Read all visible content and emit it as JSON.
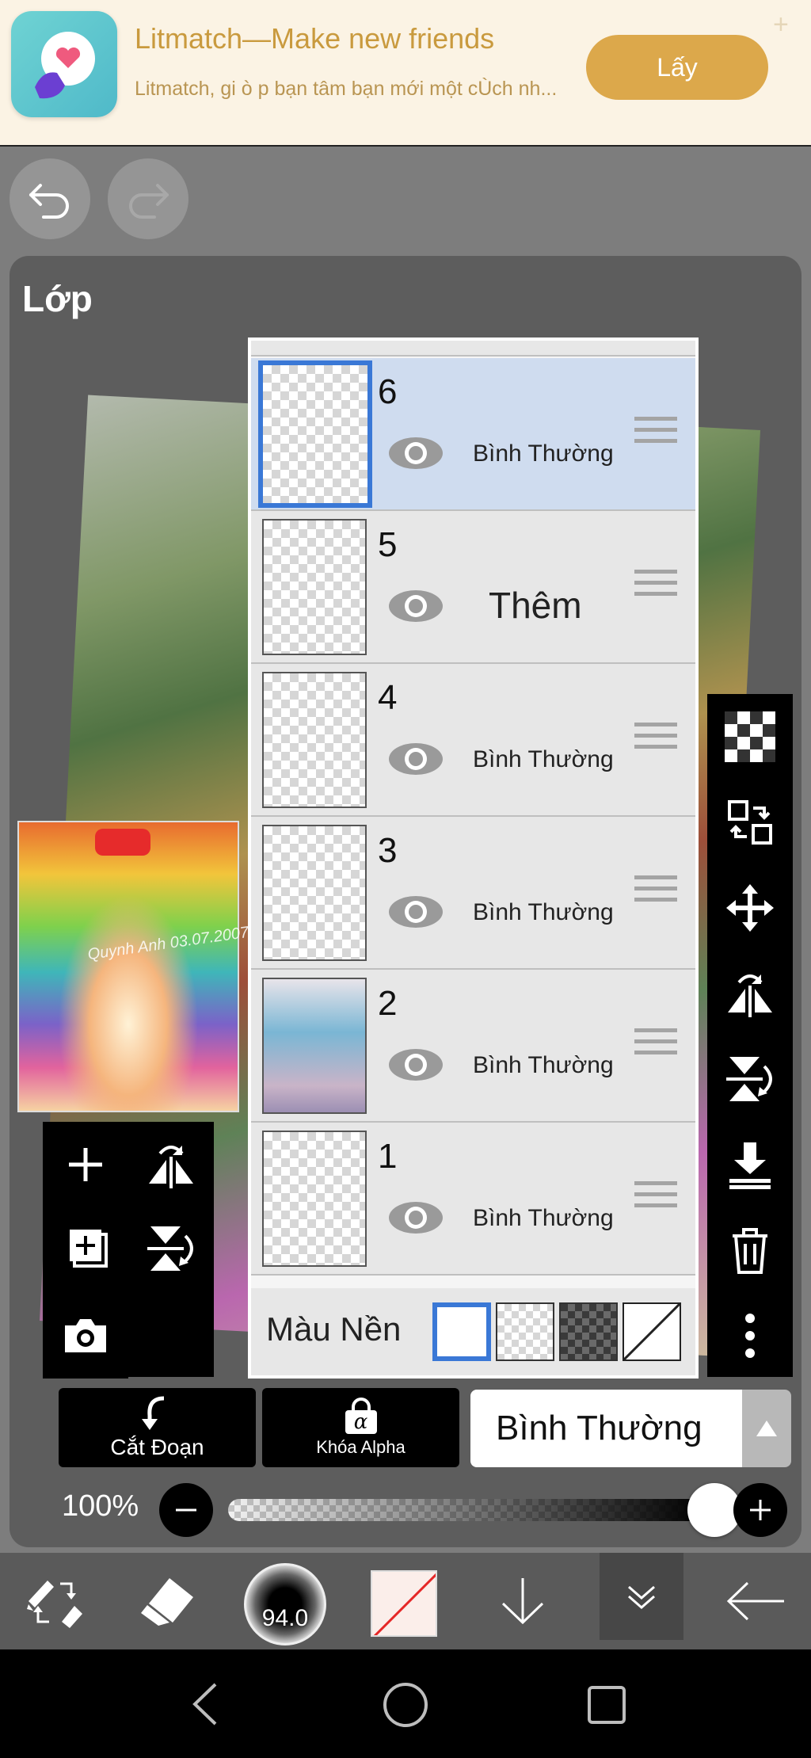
{
  "ad": {
    "title": "Litmatch—Make new friends",
    "subtitle": "Litmatch, gi ò p bạn tâm bạn mới một cÙch nh...",
    "cta": "Lấy",
    "close": "+"
  },
  "panel": {
    "title": "Lớp"
  },
  "layers": [
    {
      "number": "6",
      "mode": "Bình Thường",
      "selected": true
    },
    {
      "number": "5",
      "mode": "Thêm",
      "selected": false
    },
    {
      "number": "4",
      "mode": "Bình Thường",
      "selected": false
    },
    {
      "number": "3",
      "mode": "Bình Thường",
      "selected": false
    },
    {
      "number": "2",
      "mode": "Bình Thường",
      "selected": false
    },
    {
      "number": "1",
      "mode": "Bình Thường",
      "selected": false
    }
  ],
  "background": {
    "label": "Màu Nền",
    "options": [
      "white",
      "transparent",
      "dark-checker",
      "none"
    ],
    "selected": "white"
  },
  "thumbnail": {
    "signature": "Quynh Anh 03.07.2007"
  },
  "controls": {
    "cut_label": "Cắt Đoạn",
    "alpha_label": "Khóa Alpha",
    "alpha_symbol": "α",
    "blend_mode": "Bình Thường",
    "opacity_label": "100%",
    "opacity_value": 1.0
  },
  "toolbar": {
    "brush_size": "94.0"
  },
  "colors": {
    "accent": "#3a78d6",
    "ad_button": "#dca84b",
    "panel": "#5d5d5d"
  }
}
